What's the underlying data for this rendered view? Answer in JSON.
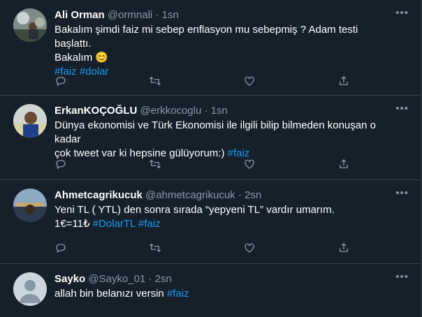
{
  "tweets": [
    {
      "name": "Ali Orman",
      "handle": "@ormnali",
      "sep": "·",
      "time": "1sn",
      "lines": [
        "Bakalım şimdi faiz mi sebep enflasyon mu sebepmiş ? Adam testi başlattı.",
        "Bakalım"
      ],
      "emoji": "😊",
      "tags": [
        "#faiz",
        "#dolar"
      ]
    },
    {
      "name": "ErkanKOÇOĞLU",
      "handle": "@erkkocoglu",
      "sep": "·",
      "time": "1sn",
      "lines": [
        "Dünya ekonomisi ve Türk Ekonomisi ile ilgili bilip bilmeden konuşan o kadar",
        "çok tweet var ki hepsine gülüyorum:)"
      ],
      "tags": [
        "#faiz"
      ]
    },
    {
      "name": "Ahmetcagrikucuk",
      "handle": "@ahmetcagrikucuk",
      "sep": "·",
      "time": "2sn",
      "lines": [
        "Yeni TL ( YTL) den sonra sırada “yepyeni TL” vardır umarım.",
        "1€=11₺"
      ],
      "tags": [
        "#DolarTL",
        "#faiz"
      ]
    },
    {
      "name": "Sayko",
      "handle": "@Sayko_01",
      "sep": "·",
      "time": "2sn",
      "lines": [
        "allah bin belanızı versin"
      ],
      "tags": [
        "#faiz"
      ]
    }
  ],
  "more_glyph": "•••",
  "action_icons": [
    "reply-icon",
    "retweet-icon",
    "like-icon",
    "share-icon"
  ],
  "colors": {
    "background": "#15202b",
    "border": "#38444d",
    "secondary": "#8899a6",
    "link": "#1d9bf0"
  }
}
